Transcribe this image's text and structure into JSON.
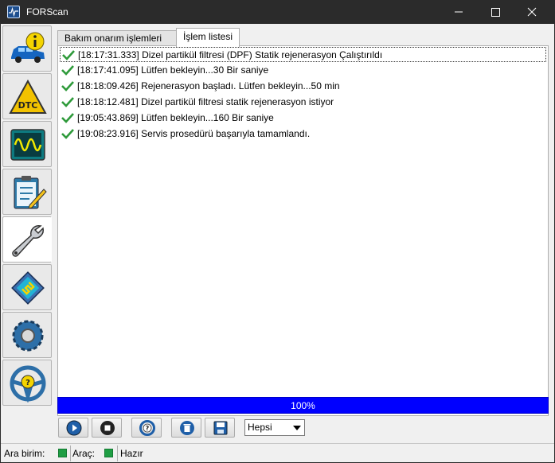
{
  "window": {
    "title": "FORScan"
  },
  "sidebar": {
    "items": [
      {
        "name": "vehicle-info",
        "icon": "car-info-icon"
      },
      {
        "name": "dtc",
        "icon": "dtc-warning-icon"
      },
      {
        "name": "oscilloscope",
        "icon": "oscilloscope-icon"
      },
      {
        "name": "tests",
        "icon": "checklist-icon"
      },
      {
        "name": "service",
        "icon": "wrench-icon",
        "active": true
      },
      {
        "name": "configuration",
        "icon": "chip-icon"
      },
      {
        "name": "settings",
        "icon": "gear-icon"
      },
      {
        "name": "help",
        "icon": "steering-help-icon"
      }
    ]
  },
  "tabs": [
    {
      "label": "Bakım onarım işlemleri",
      "active": false
    },
    {
      "label": "İşlem listesi",
      "active": true
    }
  ],
  "log": [
    {
      "text": "[18:17:31.333] Dizel partikül filtresi (DPF) Statik rejenerasyon Çalıştırıldı",
      "status": "ok"
    },
    {
      "text": "[18:17:41.095] Lütfen bekleyin...30 Bir saniye",
      "status": "ok"
    },
    {
      "text": "[18:18:09.426] Rejenerasyon başladı. Lütfen bekleyin...50 min",
      "status": "ok"
    },
    {
      "text": "[18:18:12.481] Dizel partikül filtresi statik rejenerasyon istiyor",
      "status": "ok"
    },
    {
      "text": "[19:05:43.869] Lütfen bekleyin...160 Bir saniye",
      "status": "ok"
    },
    {
      "text": "[19:08:23.916] Servis prosedürü başarıyla tamamlandı.",
      "status": "ok"
    }
  ],
  "progress": {
    "label": "100%",
    "value": 1.0
  },
  "toolbar": {
    "buttons": [
      "play-icon",
      "stop-icon",
      "help-lifebuoy-icon",
      "delete-icon",
      "save-icon"
    ],
    "filter": {
      "selected": "Hepsi"
    }
  },
  "status": {
    "interface_label": "Ara birim:",
    "vehicle_label": "Araç:",
    "state": "Hazır"
  },
  "colors": {
    "accent": "#0000ff",
    "ok": "#1f9e44",
    "check": "#2e9a3a"
  }
}
